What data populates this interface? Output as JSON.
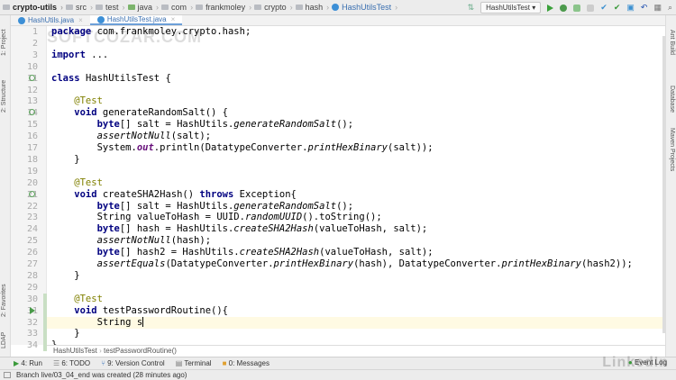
{
  "navbar": {
    "crumbs": [
      "crypto-utils",
      "src",
      "test",
      "java",
      "com",
      "frankmoley",
      "crypto",
      "hash",
      "HashUtilsTest"
    ]
  },
  "toolbar": {
    "run_config": "HashUtilsTest",
    "icons": [
      "run-icon",
      "debug-icon",
      "coverage-icon",
      "stop-icon",
      "vcs-update-icon",
      "vcs-commit-icon",
      "vcs-history-icon",
      "revert-icon",
      "project-structure-icon",
      "search-icon"
    ]
  },
  "tabs": [
    {
      "label": "HashUtils.java",
      "active": false
    },
    {
      "label": "HashUtilsTest.java",
      "active": true
    }
  ],
  "left_strip": [
    "1: Project",
    "2: Structure",
    "2: Favorites",
    "LDAP"
  ],
  "right_strip": [
    "Ant Build",
    "Database",
    "Maven Projects"
  ],
  "code": [
    {
      "n": "1",
      "t": [
        [
          "package ",
          "k"
        ],
        [
          "com.frankmoley.crypto.hash;",
          ""
        ]
      ]
    },
    {
      "n": "2",
      "t": []
    },
    {
      "n": "3",
      "t": [
        [
          "import ",
          "k"
        ],
        [
          "...",
          ""
        ]
      ]
    },
    {
      "n": "10",
      "t": []
    },
    {
      "n": "11",
      "t": [
        [
          "class ",
          "k"
        ],
        [
          "HashUtilsTest {",
          ""
        ]
      ],
      "icon": "run-circle"
    },
    {
      "n": "12",
      "t": []
    },
    {
      "n": "13",
      "t": [
        [
          "    @Test",
          "a"
        ]
      ]
    },
    {
      "n": "14",
      "t": [
        [
          "    void ",
          "k"
        ],
        [
          "generateRandomSalt() {",
          ""
        ]
      ],
      "icon": "run-circle"
    },
    {
      "n": "15",
      "t": [
        [
          "        byte",
          "k"
        ],
        [
          "[] salt = HashUtils.",
          ""
        ],
        [
          "generateRandomSalt",
          "i"
        ],
        [
          "();",
          ""
        ]
      ]
    },
    {
      "n": "16",
      "t": [
        [
          "        assertNotNull",
          "i"
        ],
        [
          "(salt);",
          ""
        ]
      ]
    },
    {
      "n": "17",
      "t": [
        [
          "        System.",
          ""
        ],
        [
          "out",
          "f"
        ],
        [
          ".println(DatatypeConverter.",
          ""
        ],
        [
          "printHexBinary",
          "i"
        ],
        [
          "(salt));",
          ""
        ]
      ]
    },
    {
      "n": "18",
      "t": [
        [
          "    }",
          ""
        ]
      ]
    },
    {
      "n": "19",
      "t": []
    },
    {
      "n": "20",
      "t": [
        [
          "    @Test",
          "a"
        ]
      ]
    },
    {
      "n": "21",
      "t": [
        [
          "    void ",
          "k"
        ],
        [
          "createSHA2Hash() ",
          ""
        ],
        [
          "throws ",
          "k"
        ],
        [
          "Exception{",
          ""
        ]
      ],
      "icon": "run-circle"
    },
    {
      "n": "22",
      "t": [
        [
          "        byte",
          "k"
        ],
        [
          "[] salt = HashUtils.",
          ""
        ],
        [
          "generateRandomSalt",
          "i"
        ],
        [
          "();",
          ""
        ]
      ]
    },
    {
      "n": "23",
      "t": [
        [
          "        String valueToHash = UUID.",
          ""
        ],
        [
          "randomUUID",
          "i"
        ],
        [
          "().toString();",
          ""
        ]
      ]
    },
    {
      "n": "24",
      "t": [
        [
          "        byte",
          "k"
        ],
        [
          "[] hash = HashUtils.",
          ""
        ],
        [
          "createSHA2Hash",
          "i"
        ],
        [
          "(valueToHash, salt);",
          ""
        ]
      ]
    },
    {
      "n": "25",
      "t": [
        [
          "        assertNotNull",
          "i"
        ],
        [
          "(hash);",
          ""
        ]
      ]
    },
    {
      "n": "26",
      "t": [
        [
          "        byte",
          "k"
        ],
        [
          "[] hash2 = HashUtils.",
          ""
        ],
        [
          "createSHA2Hash",
          "i"
        ],
        [
          "(valueToHash, salt);",
          ""
        ]
      ]
    },
    {
      "n": "27",
      "t": [
        [
          "        assertEquals",
          "i"
        ],
        [
          "(DatatypeConverter.",
          ""
        ],
        [
          "printHexBinary",
          "i"
        ],
        [
          "(hash), DatatypeConverter.",
          ""
        ],
        [
          "printHexBinary",
          "i"
        ],
        [
          "(hash2));",
          ""
        ]
      ]
    },
    {
      "n": "28",
      "t": [
        [
          "    }",
          ""
        ]
      ]
    },
    {
      "n": "29",
      "t": []
    },
    {
      "n": "30",
      "t": [
        [
          "    @Test",
          "a"
        ]
      ]
    },
    {
      "n": "31",
      "t": [
        [
          "    void ",
          "k"
        ],
        [
          "testPasswordRoutine(){",
          ""
        ]
      ],
      "icon": "run-triangle"
    },
    {
      "n": "32",
      "t": [
        [
          "        String s",
          ""
        ]
      ],
      "cursor": true
    },
    {
      "n": "33",
      "t": [
        [
          "    }",
          ""
        ]
      ]
    },
    {
      "n": "34",
      "t": [
        [
          "}",
          ""
        ]
      ]
    }
  ],
  "editor_breadcrumb": [
    "HashUtilsTest",
    "testPasswordRoutine()"
  ],
  "tool_windows": [
    {
      "label": "4: Run",
      "icon": "run-icon"
    },
    {
      "label": "6: TODO",
      "icon": "todo-icon"
    },
    {
      "label": "9: Version Control",
      "icon": "vcs-icon"
    },
    {
      "label": "Terminal",
      "icon": "terminal-icon"
    },
    {
      "label": "0: Messages",
      "icon": "messages-icon"
    }
  ],
  "event_log": "Event Log",
  "status": "Branch live/03_04_end was created (28 minutes ago)",
  "watermarks": [
    "SOFTCOZAR.COM",
    "LinkedIn"
  ],
  "colors": {
    "keyword": "#000080",
    "annotation": "#808000",
    "static_field": "#660e7a",
    "run_green": "#3aa13a"
  }
}
